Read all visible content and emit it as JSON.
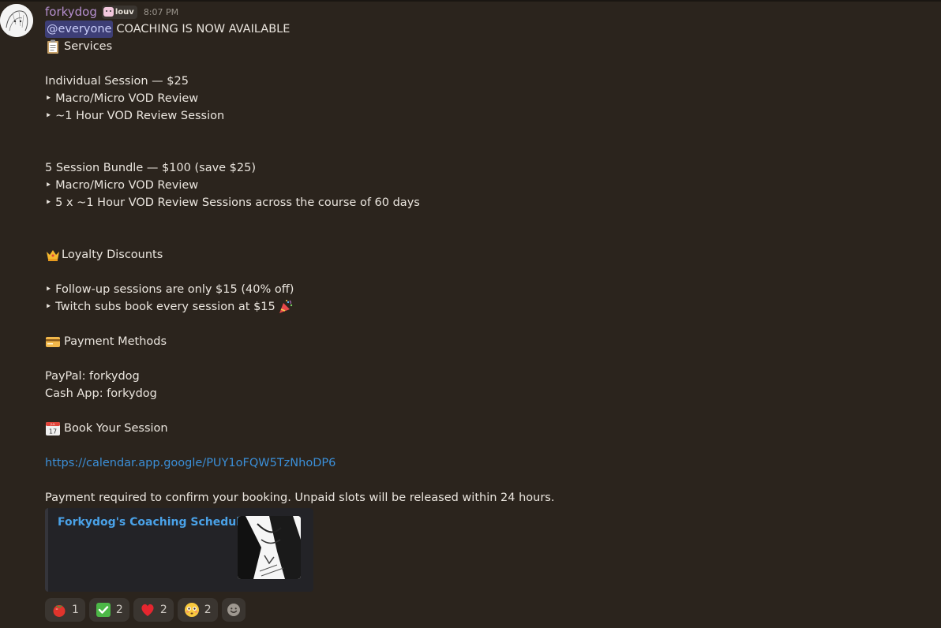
{
  "message": {
    "username": "forkydog",
    "tag": "louv",
    "timestamp": "8:07 PM",
    "mention": "@everyone",
    "headline": "COACHING IS NOW AVAILABLE",
    "services_title": "Services",
    "individual_title": "Individual Session — $25",
    "individual_item1": "‣ Macro/Micro VOD Review",
    "individual_item2": "‣ ~1 Hour VOD Review Session",
    "bundle_title": "5 Session Bundle — $100 (save $25)",
    "bundle_item1": "‣ Macro/Micro VOD Review",
    "bundle_item2": "‣ 5 x ~1 Hour VOD Review Sessions across the course of 60 days",
    "loyalty_title": "Loyalty Discounts",
    "loyalty_item1": "‣ Follow-up sessions are only $15 (40% off)",
    "loyalty_item2": "‣ Twitch subs book every session at $15",
    "payment_title": "Payment Methods",
    "paypal": "PayPal: forkydog",
    "cashapp": "Cash App: forkydog",
    "book_title": "Book Your Session",
    "link": "https://calendar.app.google/PUY1oFQW5TzNhoDP6",
    "note": "Payment required to confirm your booking. Unpaid slots will be released within 24 hours."
  },
  "embed": {
    "title": "Forkydog's Coaching Schedule"
  },
  "reactions": [
    {
      "emoji": "tomato",
      "count": "1"
    },
    {
      "emoji": "check-mark",
      "count": "2"
    },
    {
      "emoji": "red-heart",
      "count": "2"
    },
    {
      "emoji": "flushed-face",
      "count": "2"
    }
  ],
  "colors": {
    "background": "#2b241d",
    "username": "#b58fcf",
    "mention_bg": "#3d3e76",
    "link": "#3b8fd8",
    "embed_title": "#4aa2e8"
  }
}
